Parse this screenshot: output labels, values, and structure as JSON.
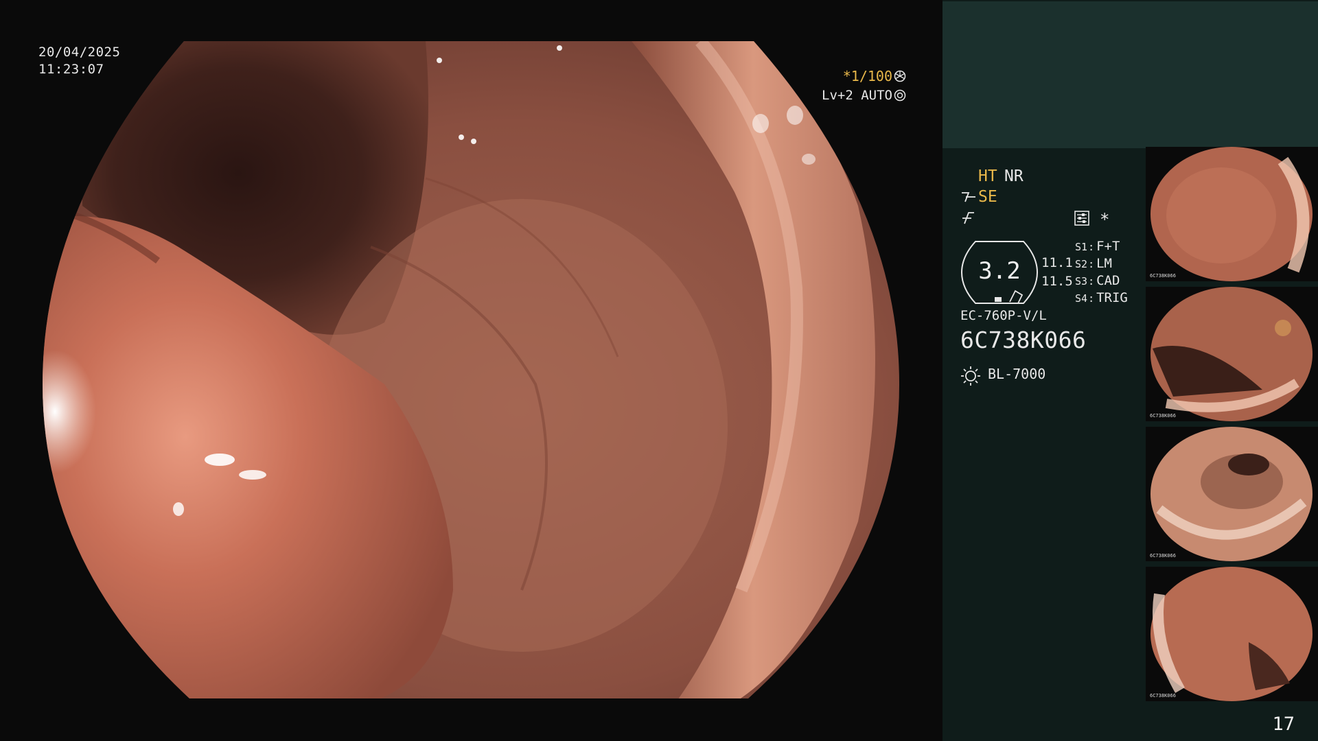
{
  "overlay": {
    "date": "20/04/2025",
    "time": "11:23:07",
    "shutter": "*1/100",
    "iris": "Lv+2 AUTO"
  },
  "processor_panel": {
    "ht": "HT",
    "nr": "NR",
    "se": "SE",
    "asterisk": "*",
    "gauge_value": "3.2",
    "gauge_v1": "11.1",
    "gauge_v2": "11.5",
    "switches": [
      {
        "key": "S1",
        "value": "F+T"
      },
      {
        "key": "S2",
        "value": "LM"
      },
      {
        "key": "S3",
        "value": "CAD"
      },
      {
        "key": "S4",
        "value": "TRIG"
      }
    ],
    "scope_model": "EC-760P-V/L",
    "scope_serial": "6C738K066",
    "light_source": "BL-7000"
  },
  "thumbnails": [
    {
      "label": "6C738K066"
    },
    {
      "label": "6C738K066"
    },
    {
      "label": "6C738K066"
    },
    {
      "label": "6C738K066"
    }
  ],
  "page_number": "17",
  "colors": {
    "accent_amber": "#e9b84a",
    "panel_bg": "#0f1c1a",
    "panel_top": "#1b302d",
    "tissue": "#b0644a"
  }
}
